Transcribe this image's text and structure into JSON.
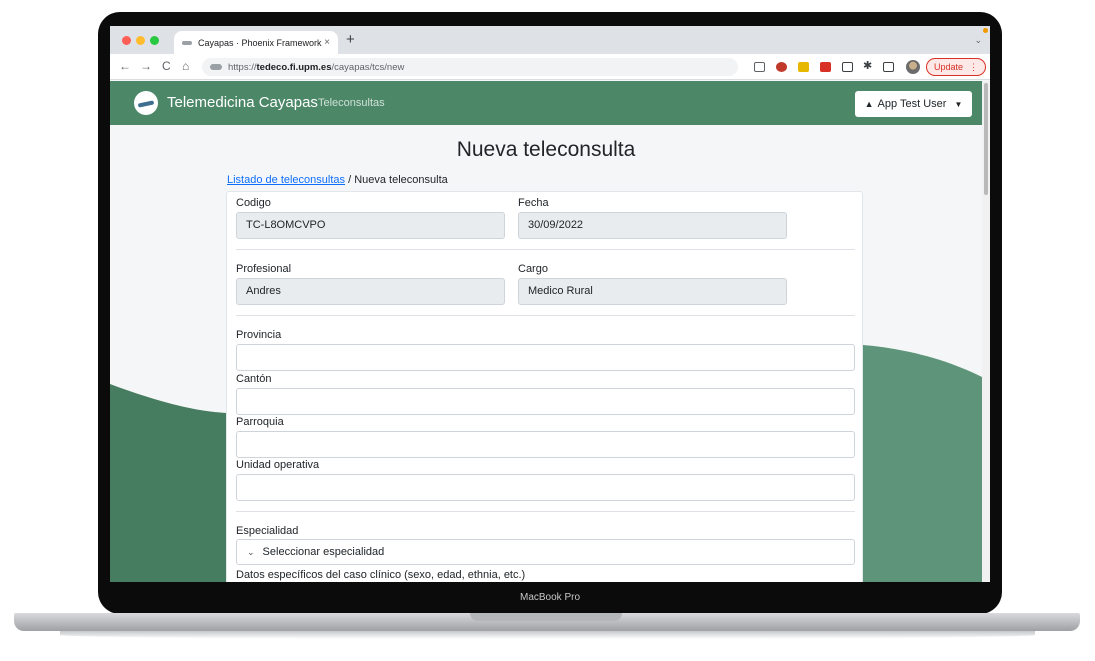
{
  "device": {
    "label": "MacBook Pro"
  },
  "browser": {
    "tab_title": "Cayapas · Phoenix Framework",
    "tab_close": "×",
    "new_tab": "+",
    "url_scheme": "https://",
    "url_host": "tedeco.fi.upm.es",
    "url_path": "/cayapas/tcs/new",
    "update_label": "Update",
    "update_more": "⋮",
    "nav_back": "←",
    "nav_forward": "→",
    "nav_reload": "C",
    "nav_home": "⌂",
    "tab_list_chevron": "⌄",
    "extension_colors": [
      "#5f6368",
      "#c0392b",
      "#e6b800",
      "#d93025",
      "#3c4043",
      "#3c4043",
      "#3c4043"
    ]
  },
  "app": {
    "brand": "Telemedicina Cayapas",
    "nav_link": "Teleconsultas",
    "user_menu": "App Test User",
    "user_icon": "▲",
    "caret": "▼",
    "accent_color": "#4c8868"
  },
  "page": {
    "title": "Nueva teleconsulta",
    "breadcrumb_link": "Listado de teleconsultas",
    "breadcrumb_separator": " / ",
    "breadcrumb_current": "Nueva teleconsulta"
  },
  "form": {
    "codigo_label": "Codigo",
    "codigo_value": "TC-L8OMCVPO",
    "fecha_label": "Fecha",
    "fecha_value": "30/09/2022",
    "profesional_label": "Profesional",
    "profesional_value": "Andres",
    "cargo_label": "Cargo",
    "cargo_value": "Medico Rural",
    "provincia_label": "Provincia",
    "provincia_value": "",
    "canton_label": "Cantón",
    "canton_value": "",
    "parroquia_label": "Parroquia",
    "parroquia_value": "",
    "unidad_label": "Unidad operativa",
    "unidad_value": "",
    "especialidad_label": "Especialidad",
    "especialidad_selected": "Seleccionar especialidad",
    "datos_label": "Datos específicos del caso clínico (sexo, edad, ethnia, etc.)"
  }
}
